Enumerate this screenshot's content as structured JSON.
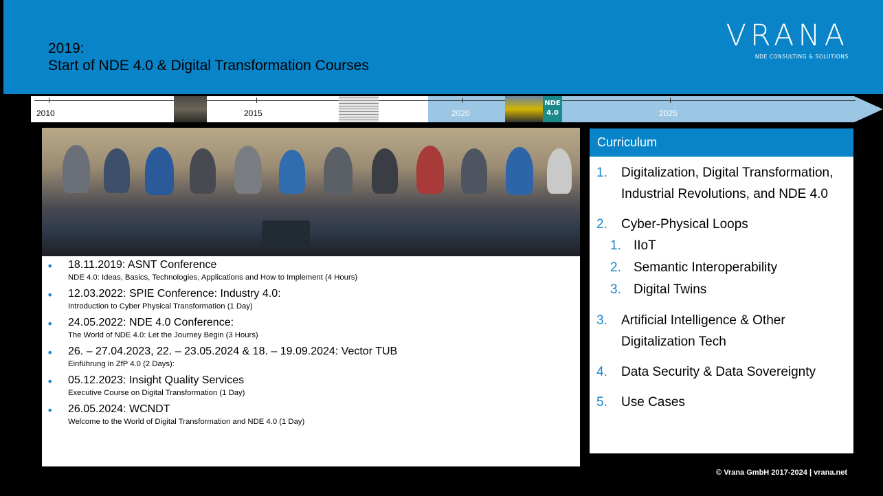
{
  "header": {
    "title_line1": "2019:",
    "title_line2": "Start of NDE 4.0 & Digital Transformation Courses",
    "logo_name": "VRANA",
    "logo_sub": "NDE CONSULTING & SOLUTIONS"
  },
  "timeline": {
    "years": [
      "2010",
      "2015",
      "2020",
      "2025"
    ],
    "nde_badge": "NDE\n4.0"
  },
  "entries": [
    {
      "main": "18.11.2019: ASNT Conference",
      "sub": "NDE 4.0: Ideas, Basics, Technologies, Applications and How to Implement  (4 Hours)"
    },
    {
      "main": "12.03.2022: SPIE Conference: Industry 4.0:",
      "sub": "Introduction to Cyber Physical Transformation (1 Day)"
    },
    {
      "main": "24.05.2022: NDE 4.0 Conference:",
      "sub": "The World of NDE 4.0: Let the Journey Begin (3 Hours)"
    },
    {
      "main": "26. – 27.04.2023, 22. – 23.05.2024 & 18. – 19.09.2024: Vector TUB",
      "sub": "Einführung in ZfP 4.0 (2 Days):"
    },
    {
      "main": "05.12.2023: Insight Quality Services",
      "sub": "Executive Course on Digital Transformation (1 Day)"
    },
    {
      "main": "26.05.2024: WCNDT",
      "sub": "Welcome to the World of Digital Transformation and NDE 4.0 (1 Day)"
    }
  ],
  "curriculum": {
    "heading": "Curriculum",
    "items": [
      {
        "num": "1.",
        "label": "Digitalization, Digital Transformation, Industrial Revolutions, and NDE 4.0"
      },
      {
        "num": "2.",
        "label": "Cyber-Physical Loops",
        "subs": [
          {
            "num": "1.",
            "label": "IIoT"
          },
          {
            "num": "2.",
            "label": "Semantic Interoperability"
          },
          {
            "num": "3.",
            "label": "Digital Twins"
          }
        ]
      },
      {
        "num": "3.",
        "label": "Artificial Intelligence & Other Digitalization Tech"
      },
      {
        "num": "4.",
        "label": "Data Security & Data Sovereignty"
      },
      {
        "num": "5.",
        "label": "Use Cases"
      }
    ]
  },
  "footer": "© Vrana GmbH 2017-2024 | vrana.net",
  "colors": {
    "accent": "#0a84c8",
    "bullet": "#1a86c9",
    "timeline_future": "#9cc7e4"
  }
}
